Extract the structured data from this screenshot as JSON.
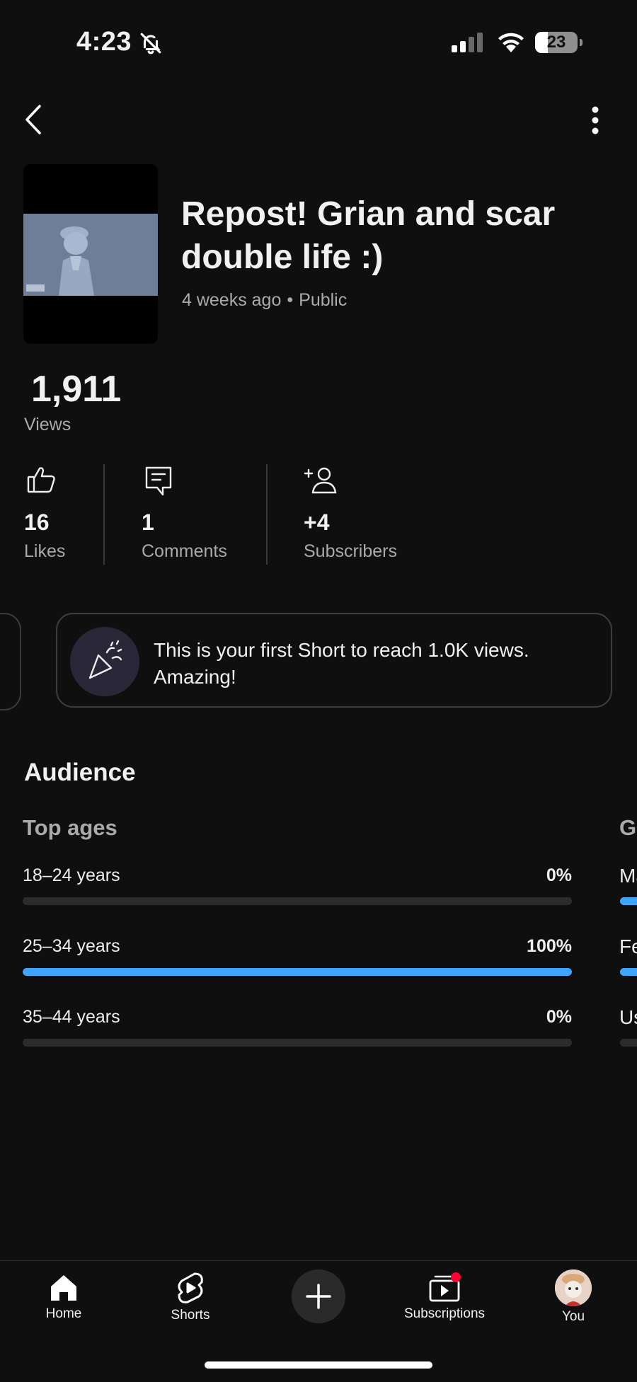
{
  "status_bar": {
    "time": "4:23",
    "battery": "23"
  },
  "video": {
    "title": "Repost! Grian and scar double life :)",
    "age": "4 weeks ago",
    "separator": "•",
    "visibility": "Public"
  },
  "views": {
    "count": "1,911",
    "label": "Views"
  },
  "stats": [
    {
      "value": "16",
      "label": "Likes",
      "icon": "thumbs-up-icon"
    },
    {
      "value": "1",
      "label": "Comments",
      "icon": "comment-icon"
    },
    {
      "value": "+4",
      "label": "Subscribers",
      "icon": "add-person-icon"
    }
  ],
  "milestone": {
    "text": "This is your first Short to reach 1.0K views. Amazing!",
    "icon": "party-popper-icon"
  },
  "audience": {
    "title": "Audience",
    "top_ages_title": "Top ages",
    "ages": [
      {
        "label": "18–24 years",
        "pct": "0%",
        "value": 0
      },
      {
        "label": "25–34 years",
        "pct": "100%",
        "value": 100
      },
      {
        "label": "35–44 years",
        "pct": "0%",
        "value": 0
      }
    ],
    "gender_peek": {
      "title": "G",
      "rows": [
        "Ma",
        "Fe",
        "Us"
      ]
    }
  },
  "nav": {
    "home": "Home",
    "shorts": "Shorts",
    "subscriptions": "Subscriptions",
    "you": "You"
  },
  "colors": {
    "accent_bar": "#3ea6ff",
    "notification_dot": "#ff0033",
    "background": "#0f0f10"
  }
}
